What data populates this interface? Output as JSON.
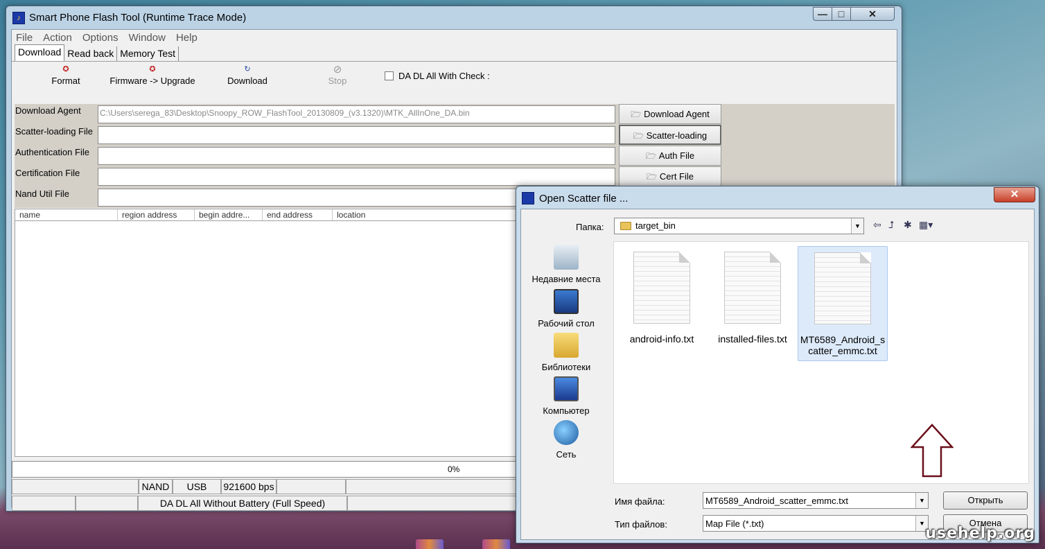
{
  "window": {
    "title": "Smart Phone Flash Tool (Runtime Trace Mode)",
    "min_glyph": "—",
    "max_glyph": "□",
    "close_glyph": "✕"
  },
  "menu": [
    "File",
    "Action",
    "Options",
    "Window",
    "Help"
  ],
  "tabs": [
    "Download",
    "Read back",
    "Memory Test"
  ],
  "toolbar": {
    "format": "Format",
    "firmware_upgrade": "Firmware -> Upgrade",
    "download": "Download",
    "stop": "Stop",
    "da_check": "DA DL All With Check :"
  },
  "files": {
    "download_agent_label": "Download Agent",
    "download_agent_value": "C:\\Users\\serega_83\\Desktop\\Snoopy_ROW_FlashTool_20130809_(v3.1320)\\MTK_AllInOne_DA.bin",
    "scatter_label": "Scatter-loading File",
    "auth_label": "Authentication File",
    "cert_label": "Certification File",
    "nand_label": "Nand Util File",
    "btn_download_agent": "Download Agent",
    "btn_scatter": "Scatter-loading",
    "btn_auth": "Auth File",
    "btn_cert": "Cert File"
  },
  "list_columns": [
    "name",
    "region address",
    "begin addre...",
    "end address",
    "location"
  ],
  "progress_text": "0%",
  "status1": [
    "",
    "NAND",
    "USB",
    "921600 bps",
    "",
    ""
  ],
  "status2": [
    "",
    "",
    "DA DL All Without Battery (Full Speed)",
    ""
  ],
  "dialog": {
    "title": "Open Scatter file ...",
    "close_glyph": "✕",
    "lookin_label": "Папка:",
    "lookin_value": "target_bin",
    "places": [
      "Недавние места",
      "Рабочий стол",
      "Библиотеки",
      "Компьютер",
      "Сеть"
    ],
    "files": [
      "android-info.txt",
      "installed-files.txt",
      "MT6589_Android_scatter_emmc.txt"
    ],
    "selected_file_line1": "MT6589_Android_s",
    "selected_file_line2": "catter_emmc.txt",
    "filename_label": "Имя файла:",
    "filename_value": "MT6589_Android_scatter_emmc.txt",
    "filetype_label": "Тип файлов:",
    "filetype_value": "Map File (*.txt)",
    "open_btn": "Открыть",
    "cancel_btn": "Отмена"
  },
  "watermark": "usehelp.org"
}
